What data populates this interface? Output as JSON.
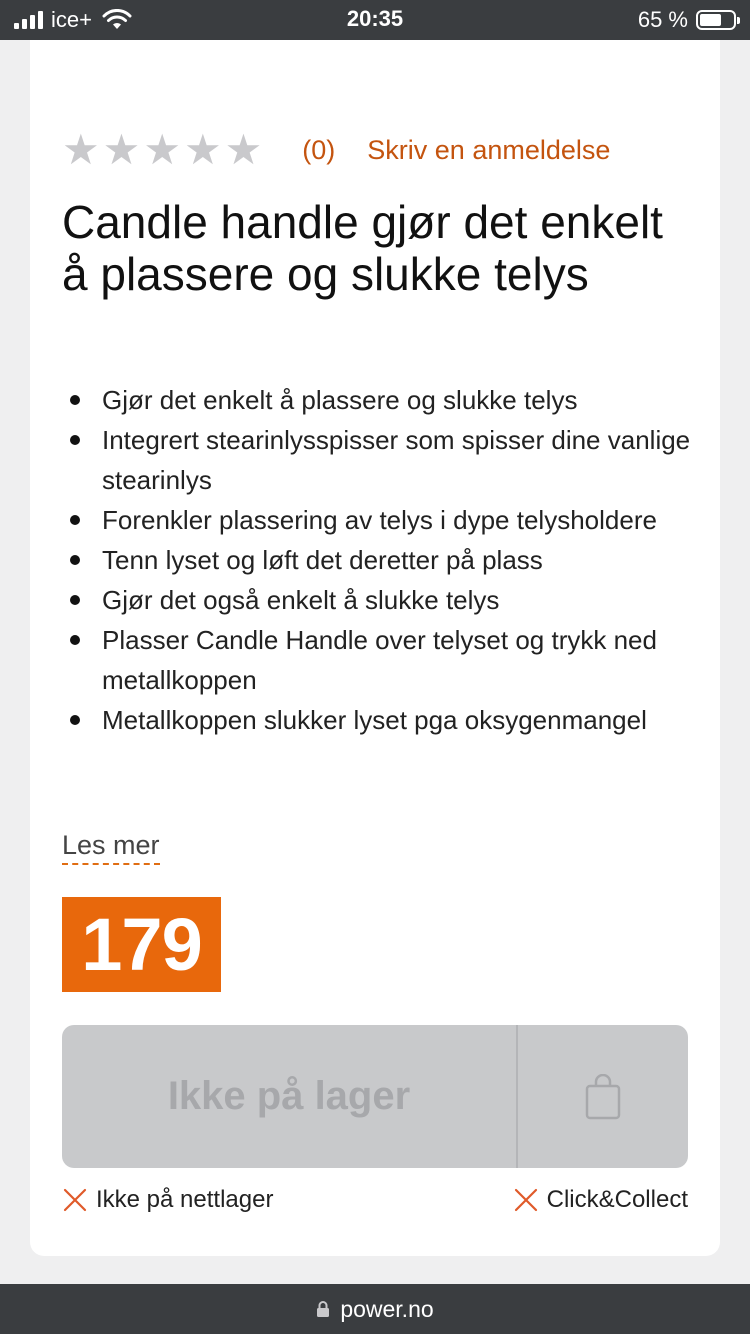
{
  "status_bar": {
    "carrier": "ice+",
    "time": "20:35",
    "battery": "65 %",
    "battery_level": 0.65
  },
  "product": {
    "rating": {
      "stars": 0,
      "max_stars": 5,
      "review_count": "(0)",
      "write_review_label": "Skriv en anmeldelse"
    },
    "title": "Candle handle gjør det enkelt å plassere og slukke telys",
    "features": [
      "Gjør det enkelt å plassere og slukke telys",
      "Integrert stearinlysspisser som spisser dine vanlige stearinlys",
      "Forenkler plassering av telys i dype telysholdere",
      "Tenn lyset og løft det deretter på plass",
      "Gjør det også enkelt å slukke telys",
      "Plasser Candle Handle over telyset og trykk ned metallkoppen",
      "Metallkoppen slukker lyset pga oksygenmangel"
    ],
    "read_more_label": "Les mer",
    "price": "179",
    "buy_button_label": "Ikke på lager",
    "availability": {
      "online": "Ikke på nettlager",
      "click_collect": "Click&Collect"
    }
  },
  "colors": {
    "accent": "#e8680c",
    "link": "#c4540f",
    "unavailable": "#e05a2a"
  },
  "browser": {
    "domain": "power.no"
  }
}
